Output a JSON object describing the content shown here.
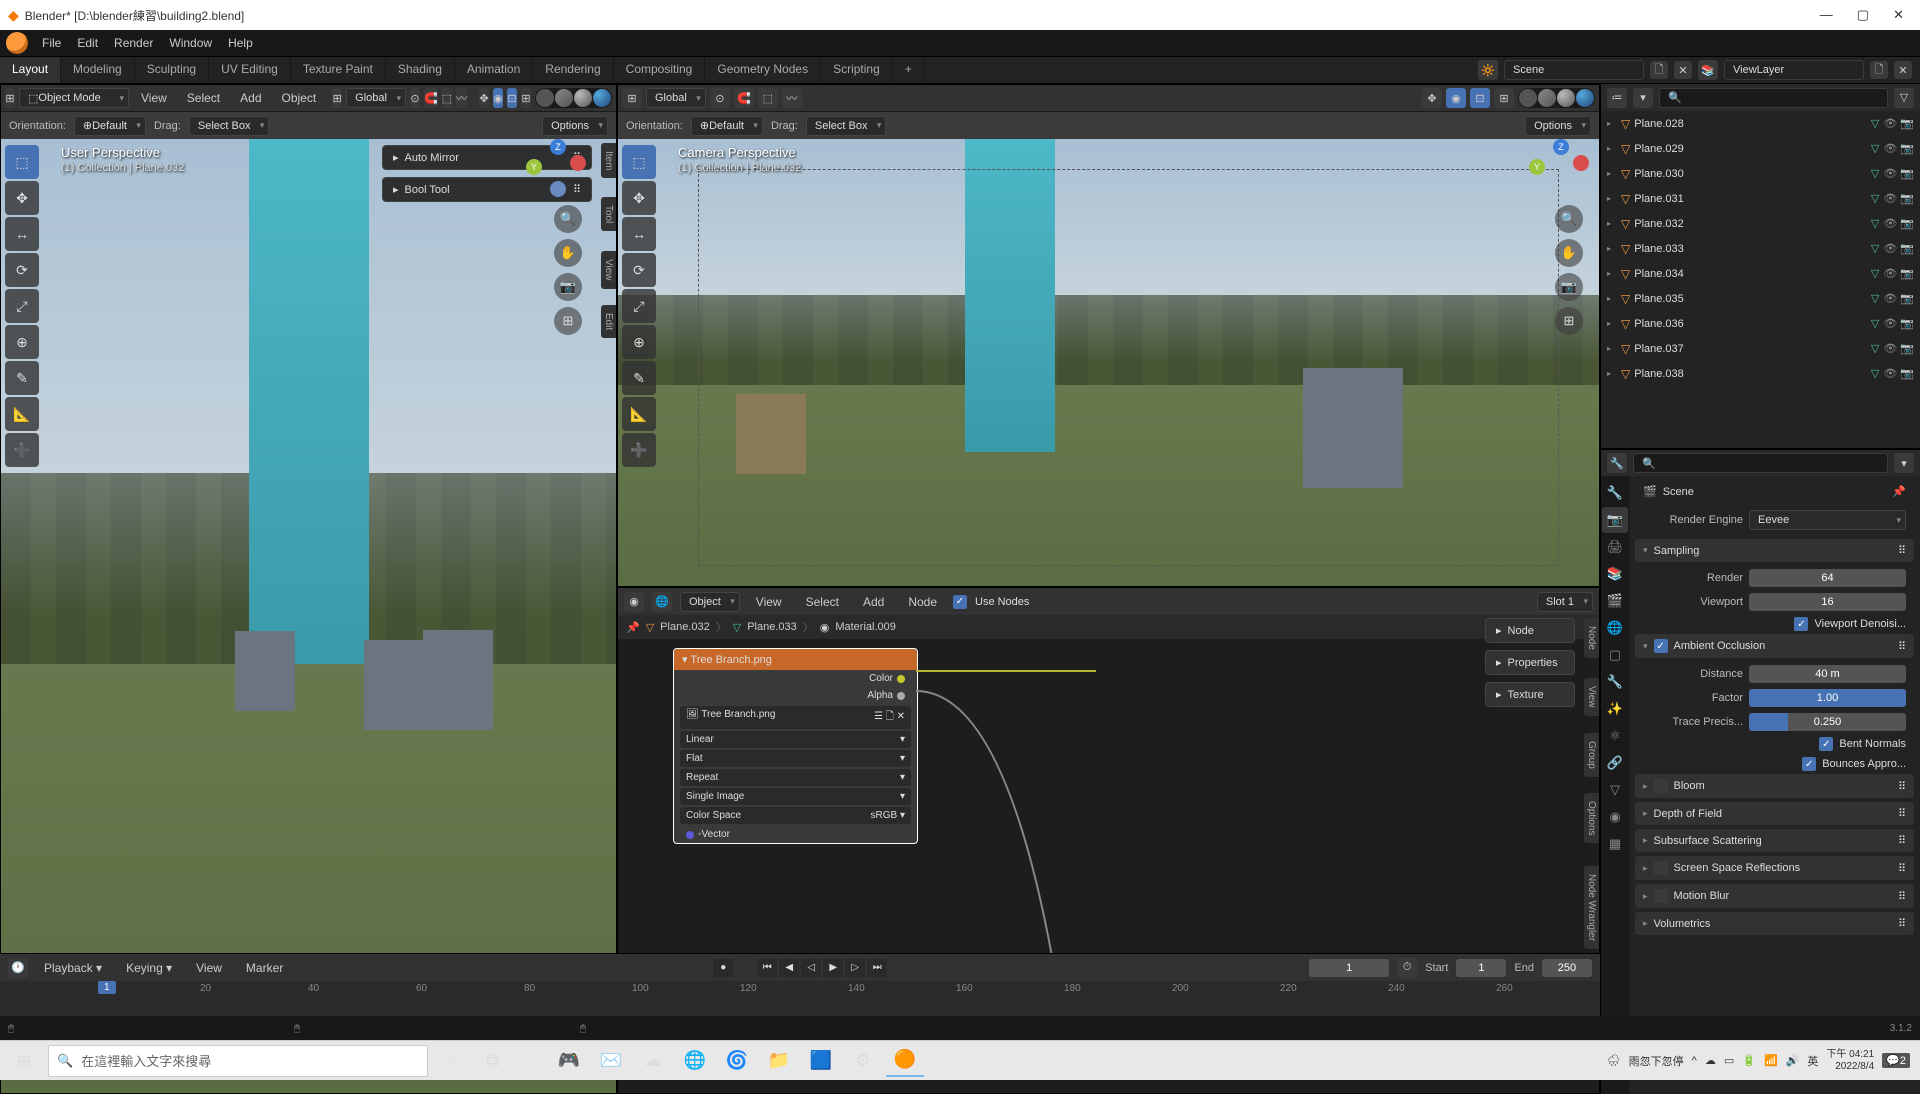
{
  "window": {
    "title": "Blender* [D:\\blender練習\\building2.blend]"
  },
  "topmenu": [
    "File",
    "Edit",
    "Render",
    "Window",
    "Help"
  ],
  "workspaces": {
    "tabs": [
      "Layout",
      "Modeling",
      "Sculpting",
      "UV Editing",
      "Texture Paint",
      "Shading",
      "Animation",
      "Rendering",
      "Compositing",
      "Geometry Nodes",
      "Scripting"
    ],
    "active": "Layout",
    "scene": "Scene",
    "viewlayer": "ViewLayer"
  },
  "viewport_left": {
    "header": {
      "orientation_mode": "Global",
      "orientation_label": "Orientation:",
      "drag_label": "Drag:",
      "transform": "Default",
      "drag": "Select Box",
      "options": "Options"
    },
    "overlay": {
      "title": "Camera Perspective",
      "sub": "(1) Collection | Plane.032"
    }
  },
  "viewport_right": {
    "header": {
      "mode": "Object Mode",
      "menus": [
        "View",
        "Select",
        "Add",
        "Object"
      ],
      "orientation_mode": "Global",
      "orientation_label": "Orientation:",
      "drag_label": "Drag:",
      "transform": "Default",
      "drag": "Select Box",
      "options": "Options"
    },
    "overlay": {
      "title": "User Perspective",
      "sub": "(1) Collection | Plane.032"
    },
    "panels": [
      "Auto Mirror",
      "Bool Tool"
    ],
    "side_tabs": [
      "Item",
      "Tool",
      "View",
      "Edit"
    ]
  },
  "node_editor": {
    "header": {
      "mode": "Object",
      "menus": [
        "View",
        "Select",
        "Add",
        "Node"
      ],
      "use_nodes_label": "Use Nodes",
      "slot": "Slot 1"
    },
    "crumb": [
      "Plane.032",
      "Plane.033",
      "Material.009"
    ],
    "side_tabs": [
      "Node",
      "Properties",
      "Texture",
      "View",
      "Group",
      "Options",
      "Node Wrangler"
    ],
    "side_panels": [
      "Node",
      "Properties",
      "Texture"
    ],
    "node": {
      "title": "Tree Branch.png",
      "outputs": [
        "Color",
        "Alpha"
      ],
      "image": "Tree Branch.png",
      "interp": "Linear",
      "projection": "Flat",
      "extension": "Repeat",
      "source": "Single Image",
      "colorspace_label": "Color Space",
      "colorspace": "sRGB",
      "vector": "Vector"
    }
  },
  "outliner": {
    "items": [
      "Plane.028",
      "Plane.029",
      "Plane.030",
      "Plane.031",
      "Plane.032",
      "Plane.033",
      "Plane.034",
      "Plane.035",
      "Plane.036",
      "Plane.037",
      "Plane.038"
    ]
  },
  "properties": {
    "scene_label": "Scene",
    "render_engine_label": "Render Engine",
    "render_engine": "Eevee",
    "sampling": {
      "title": "Sampling",
      "render_label": "Render",
      "render": "64",
      "viewport_label": "Viewport",
      "viewport": "16",
      "denoise": "Viewport Denoisi..."
    },
    "ao": {
      "title": "Ambient Occlusion",
      "distance_label": "Distance",
      "distance": "40 m",
      "factor_label": "Factor",
      "factor": "1.00",
      "trace_label": "Trace Precis...",
      "trace": "0.250",
      "bent": "Bent Normals",
      "bounces": "Bounces Appro..."
    },
    "panels": [
      "Bloom",
      "Depth of Field",
      "Subsurface Scattering",
      "Screen Space Reflections",
      "Motion Blur",
      "Volumetrics"
    ]
  },
  "timeline": {
    "menus": [
      "Playback",
      "Keying",
      "View",
      "Marker"
    ],
    "frame": "1",
    "start_label": "Start",
    "start": "1",
    "end_label": "End",
    "end": "250",
    "ticks": [
      "20",
      "40",
      "60",
      "80",
      "100",
      "120",
      "140",
      "160",
      "180",
      "200",
      "220",
      "240",
      "260"
    ]
  },
  "statusbar": {
    "version": "3.1.2"
  },
  "taskbar": {
    "search_placeholder": "在這裡輸入文字來搜尋",
    "weather": "雨忽下忽停",
    "ime": "英",
    "time": "下午 04:21",
    "date": "2022/8/4",
    "notif": "2"
  }
}
